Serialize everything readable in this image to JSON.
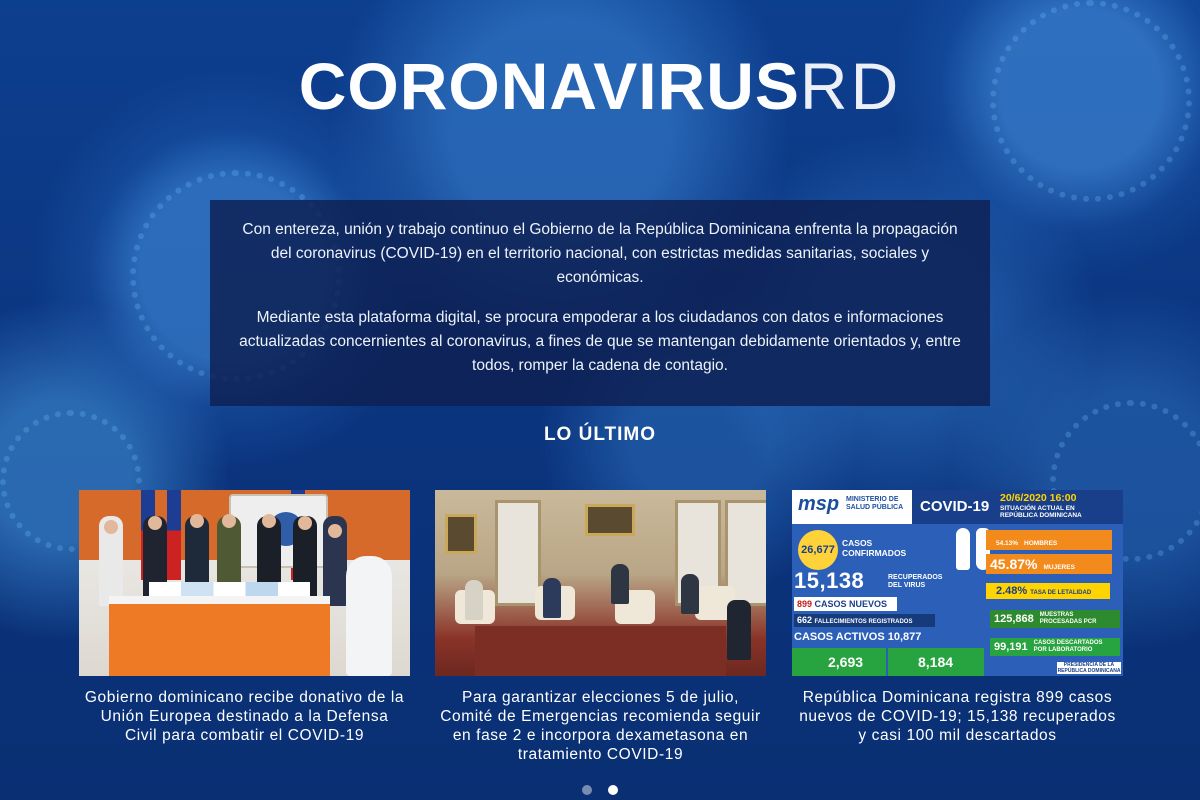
{
  "logo": {
    "bold": "CORONAVIRUS",
    "light": "RD"
  },
  "intro": {
    "paragraph_1": "Con entereza, unión y trabajo continuo el Gobierno de la República Dominicana enfrenta la propagación del coronavirus (COVID-19) en el territorio nacional, con estrictas medidas sanitarias, sociales y económicas.",
    "paragraph_2": "Mediante esta plataforma digital, se procura empoderar a los ciudadanos con datos e informaciones actualizadas concernientes al coronavirus, a fines de que se mantengan debidamente orientados y, entre todos, romper la cadena de contagio."
  },
  "latest": {
    "title": "LO ÚLTIMO",
    "cards": [
      {
        "caption": "Gobierno dominicano recibe donativo de la Unión Europea destinado a la Defensa Civil para combatir el COVID-19",
        "image_sign": "DEFENSA CIVIL"
      },
      {
        "caption": "Para garantizar elecciones 5 de julio, Comité de Emergencias recomienda seguir en fase 2 e incorpora dexametasona en tratamiento COVID-19"
      },
      {
        "caption": "República Dominicana registra 899 casos nuevos de COVID-19; 15,138 recuperados y casi 100 mil descartados"
      }
    ]
  },
  "infographic": {
    "logo": "msp",
    "ministry": "MINISTERIO DE SALUD PÚBLICA",
    "title": "COVID-19",
    "date": "20/6/2020 16:00",
    "situation": "SITUACIÓN ACTUAL EN REPÚBLICA DOMINICANA",
    "confirmed": "26,677",
    "confirmed_label": "CASOS CONFIRMADOS",
    "recovered": "15,138",
    "recovered_label": "RECUPERADOS DEL VIRUS",
    "men_pct": "54.13%",
    "men_label": "HOMBRES",
    "women_pct": "45.87%",
    "women_label": "MUJERES",
    "lethality": "2.48%",
    "lethality_label": "TASA DE LETALIDAD",
    "new_cases": "899",
    "new_cases_label": "CASOS NUEVOS",
    "deaths": "662",
    "deaths_label": "FALLECIMIENTOS REGISTRADOS",
    "active_label": "CASOS ACTIVOS",
    "active": "10,877",
    "pcr": "125,868",
    "pcr_label": "MUESTRAS PROCESADAS PCR",
    "discarded": "99,191",
    "discarded_label": "CASOS DESCARTADOS POR LABORATORIO",
    "hospital": "2,693",
    "home": "8,184",
    "footer": "PRESIDENCIA DE LA REPÚBLICA DOMINICANA"
  },
  "carousel": {
    "pages": 2,
    "active_index": 1
  }
}
